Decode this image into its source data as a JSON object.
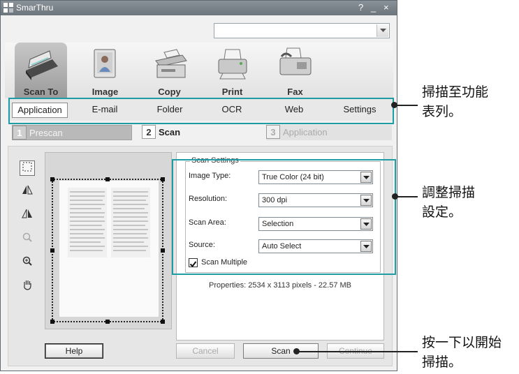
{
  "window": {
    "title": "SmarThru",
    "help_glyph": "?",
    "minimize_glyph": "_",
    "close_glyph": "×"
  },
  "functions": [
    {
      "label": "Scan To",
      "icon": "scanner-icon",
      "active": true
    },
    {
      "label": "Image",
      "icon": "image-icon",
      "active": false
    },
    {
      "label": "Copy",
      "icon": "copier-icon",
      "active": false
    },
    {
      "label": "Print",
      "icon": "printer-icon",
      "active": false
    },
    {
      "label": "Fax",
      "icon": "fax-icon",
      "active": false
    }
  ],
  "tabs": [
    {
      "label": "Application",
      "active": true
    },
    {
      "label": "E-mail",
      "active": false
    },
    {
      "label": "Folder",
      "active": false
    },
    {
      "label": "OCR",
      "active": false
    },
    {
      "label": "Web",
      "active": false
    },
    {
      "label": "Settings",
      "active": false
    }
  ],
  "steps": [
    {
      "num": "1",
      "label": "Prescan"
    },
    {
      "num": "2",
      "label": "Scan"
    },
    {
      "num": "3",
      "label": "Application"
    }
  ],
  "tools": [
    "select-area-icon",
    "flip-horizontal-icon",
    "flip-vertical-icon",
    "zoom-out-icon",
    "zoom-in-icon",
    "hand-pan-icon"
  ],
  "scan_settings": {
    "group_title": "Scan Settings",
    "image_type": {
      "label": "Image Type:",
      "value": "True Color (24 bit)"
    },
    "resolution": {
      "label": "Resolution:",
      "value": "300 dpi"
    },
    "scan_area": {
      "label": "Scan Area:",
      "value": "Selection"
    },
    "source": {
      "label": "Source:",
      "value": "Auto Select"
    },
    "scan_multiple": {
      "label": "Scan Multiple",
      "checked": true
    },
    "properties": "Properties: 2534 x 3113 pixels - 22.57 MB"
  },
  "buttons": {
    "help": "Help",
    "cancel": "Cancel",
    "scan": "Scan",
    "continue": "Continue"
  },
  "callouts": {
    "tabs_line1": "掃描至功能",
    "tabs_line2": "表列。",
    "settings_line1": "調整掃描",
    "settings_line2": "設定。",
    "scan_line1": "按一下以開始",
    "scan_line2": "掃描。"
  },
  "colors": {
    "highlight": "#1d9ca3",
    "titlebar": "#7a8188"
  }
}
